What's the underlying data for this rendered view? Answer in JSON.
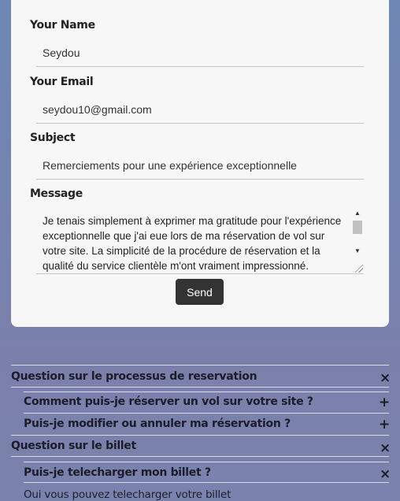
{
  "form": {
    "name_label": "Your Name",
    "name_value": "Seydou",
    "email_label": "Your Email",
    "email_value": "seydou10@gmail.com",
    "subject_label": "Subject",
    "subject_value": "Remerciements pour une expérience exceptionnelle",
    "message_label": "Message",
    "message_value": "Je tenais simplement à exprimer ma gratitude pour l'expérience exceptionnelle que j'ai eue lors de ma réservation de vol sur votre site. La simplicité de la procédure de réservation et la qualité du service clientèle m'ont vraiment impressionné.",
    "send_label": "Send"
  },
  "faq": {
    "section1_title": "Question sur le processus de reservation",
    "section1_icon": "close-icon",
    "q1": "Comment puis-je réserver un vol sur votre site ?",
    "q2": "Puis-je modifier ou annuler ma réservation ?",
    "section2_title": "Question sur le billet",
    "section2_icon": "close-icon",
    "q3": "Puis-je telecharger mon billet ?",
    "q3_answer": "Oui vous pouvez telecharger votre billet"
  }
}
